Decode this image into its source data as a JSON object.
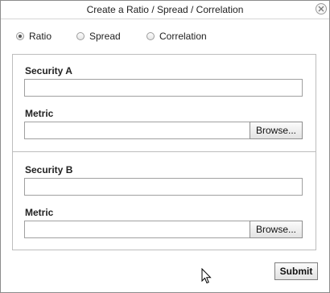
{
  "window": {
    "title": "Create a Ratio / Spread / Correlation"
  },
  "mode_options": [
    {
      "label": "Ratio",
      "selected": true
    },
    {
      "label": "Spread",
      "selected": false
    },
    {
      "label": "Correlation",
      "selected": false
    }
  ],
  "security_a": {
    "label": "Security A",
    "value": "",
    "metric_label": "Metric",
    "metric_value": "",
    "browse_label": "Browse..."
  },
  "security_b": {
    "label": "Security B",
    "value": "",
    "metric_label": "Metric",
    "metric_value": "",
    "browse_label": "Browse..."
  },
  "footer": {
    "submit_label": "Submit"
  },
  "icons": {
    "close": "close-icon",
    "cursor": "mouse-pointer-icon"
  }
}
